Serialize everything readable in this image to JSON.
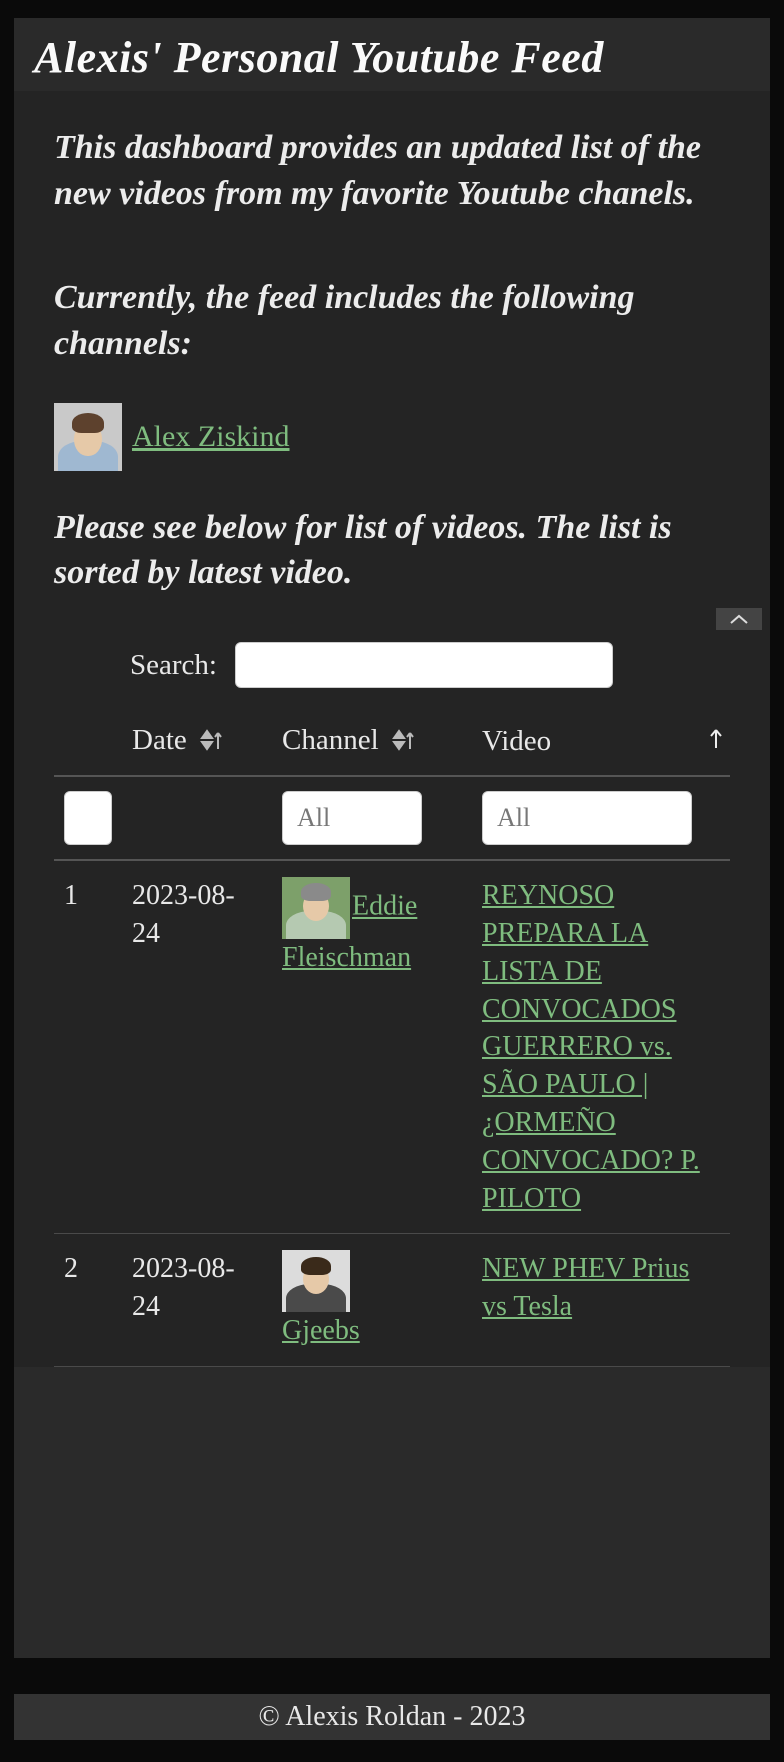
{
  "page": {
    "title": "Alexis' Personal Youtube Feed",
    "intro": "This dashboard provides an updated list of the new videos from my favorite Youtube chanels.",
    "channels_heading": "Currently, the feed includes the following channels:",
    "list_heading": "Please see below for list of videos. The list is sorted by latest video."
  },
  "channels": [
    {
      "name": "Alex Ziskind "
    }
  ],
  "search": {
    "label": "Search:",
    "value": ""
  },
  "table": {
    "headers": {
      "num": "",
      "date": "Date",
      "channel": "Channel",
      "video": "Video"
    },
    "filters": {
      "num": "",
      "channel": "All",
      "video": "All"
    },
    "rows": [
      {
        "num": "1",
        "date": "2023-08-24",
        "channel": "Eddie Fleischman",
        "video": "REYNOSO PREPARA LA LISTA DE CONVOCADOS  GUERRERO vs. SÃO PAULO | ¿ORMEÑO CONVOCADO?  P. PILOTO"
      },
      {
        "num": "2",
        "date": "2023-08-24",
        "channel": "Gjeebs",
        "video": "NEW PHEV Prius vs Tesla"
      }
    ]
  },
  "footer": "© Alexis Roldan - 2023"
}
